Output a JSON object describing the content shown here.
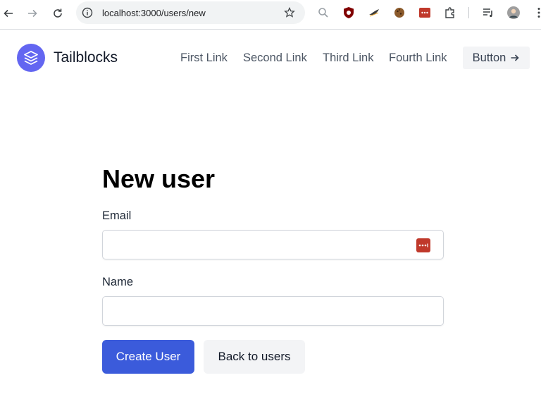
{
  "browser": {
    "url": "localhost:3000/users/new"
  },
  "header": {
    "brand": "Tailblocks",
    "nav": [
      {
        "label": "First Link"
      },
      {
        "label": "Second Link"
      },
      {
        "label": "Third Link"
      },
      {
        "label": "Fourth Link"
      }
    ],
    "button_label": "Button"
  },
  "form": {
    "title": "New user",
    "email_label": "Email",
    "email_value": "",
    "name_label": "Name",
    "name_value": "",
    "submit_label": "Create User",
    "back_label": "Back to users"
  },
  "colors": {
    "accent": "#6366f1",
    "primary_button": "#3b5bdb",
    "secondary_button": "#f3f4f6"
  }
}
